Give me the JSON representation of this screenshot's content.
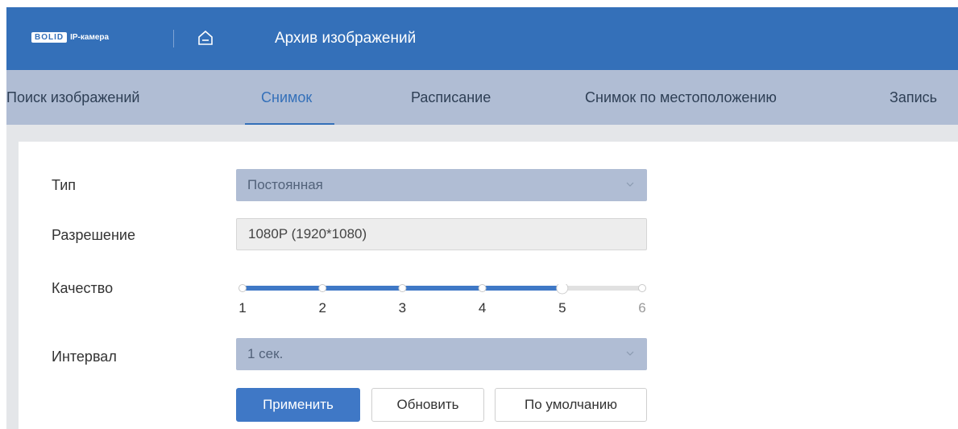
{
  "header": {
    "logo_box": "BOLID",
    "logo_text": "IP-камера",
    "title": "Архив изображений"
  },
  "tabs": [
    {
      "label": "Поиск изображений",
      "active": false
    },
    {
      "label": "Снимок",
      "active": true
    },
    {
      "label": "Расписание",
      "active": false
    },
    {
      "label": "Снимок по местоположению",
      "active": false
    },
    {
      "label": "Запись",
      "active": false
    }
  ],
  "form": {
    "type_label": "Тип",
    "type_value": "Постоянная",
    "resolution_label": "Разрешение",
    "resolution_value": "1080P (1920*1080)",
    "quality_label": "Качество",
    "quality_ticks": [
      "1",
      "2",
      "3",
      "4",
      "5",
      "6"
    ],
    "quality_value": 5,
    "quality_max": 6,
    "interval_label": "Интервал",
    "interval_value": "1 сек."
  },
  "buttons": {
    "apply": "Применить",
    "refresh": "Обновить",
    "default": "По умолчанию"
  },
  "colors": {
    "accent": "#3470b9",
    "tab_bar": "#b0bdd4",
    "select_bg": "#b0bdd4"
  },
  "icons": {
    "home": "home-icon",
    "chevron": "chevron-down-icon"
  }
}
